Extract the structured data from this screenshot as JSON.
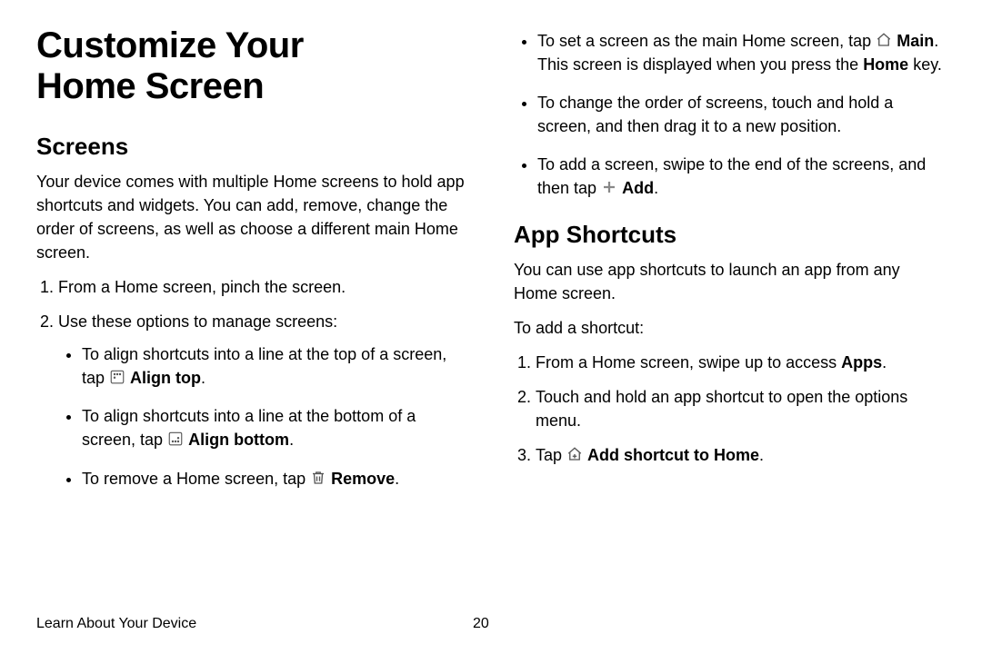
{
  "page_title_line1": "Customize Your",
  "page_title_line2": "Home Screen",
  "screens": {
    "heading": "Screens",
    "intro": "Your device comes with multiple Home screens to hold app shortcuts and widgets. You can add, remove, change the order of screens, as well as choose a different main Home screen.",
    "step1": "From a Home screen, pinch the screen.",
    "step2": "Use these options to manage screens:",
    "bullet_align_top_pre": "To align shortcuts into a line at the top of a screen, tap ",
    "bullet_align_top_label": "Align top",
    "bullet_align_bottom_pre": "To align shortcuts into a line at the bottom of a screen, tap ",
    "bullet_align_bottom_label": "Align bottom",
    "bullet_remove_pre": "To remove a Home screen, tap ",
    "bullet_remove_label": "Remove",
    "bullet_main_pre": "To set a screen as the main Home screen, tap ",
    "bullet_main_label": "Main",
    "bullet_main_post": ". This screen is displayed when you press the ",
    "bullet_main_homekey": "Home",
    "bullet_main_end": " key.",
    "bullet_reorder": "To change the order of screens, touch and hold a screen, and then drag it to a new position.",
    "bullet_add_pre": "To add a screen, swipe to the end of the screens, and then tap ",
    "bullet_add_label": "Add"
  },
  "app_shortcuts": {
    "heading": "App Shortcuts",
    "intro": "You can use app shortcuts to launch an app from any Home screen.",
    "lead": "To add a shortcut:",
    "step1_pre": "From a Home screen, swipe up to access ",
    "step1_bold": "Apps",
    "step2": "Touch and hold an app shortcut to open the options menu.",
    "step3_pre": "Tap ",
    "step3_label": "Add shortcut to Home"
  },
  "footer": {
    "section": "Learn About Your Device",
    "page": "20"
  },
  "period": "."
}
